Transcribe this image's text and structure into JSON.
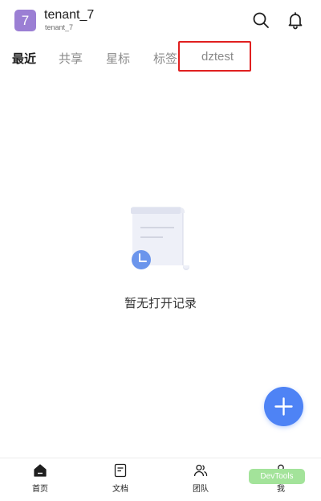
{
  "header": {
    "avatar_text": "7",
    "tenant_name": "tenant_7",
    "tenant_sub": "tenant_7",
    "icons": [
      "search-icon",
      "bell-icon"
    ]
  },
  "tabs": [
    {
      "label": "最近",
      "active": true
    },
    {
      "label": "共享",
      "active": false
    },
    {
      "label": "星标",
      "active": false
    },
    {
      "label": "标签",
      "active": false
    },
    {
      "label": "dztest",
      "active": false
    }
  ],
  "empty_state": {
    "message": "暂无打开记录",
    "icon": "document-clock-icon"
  },
  "fab": {
    "icon": "plus-icon"
  },
  "bottom_nav": [
    {
      "label": "首页",
      "icon": "home-icon"
    },
    {
      "label": "文档",
      "icon": "document-icon"
    },
    {
      "label": "团队",
      "icon": "team-icon"
    },
    {
      "label": "我",
      "icon": "user-icon"
    }
  ],
  "devtools_label": "DevTools",
  "colors": {
    "avatar": "#9b7fd4",
    "accent": "#4e83f5",
    "highlight": "#e02020",
    "devtools": "#a3e39a"
  }
}
